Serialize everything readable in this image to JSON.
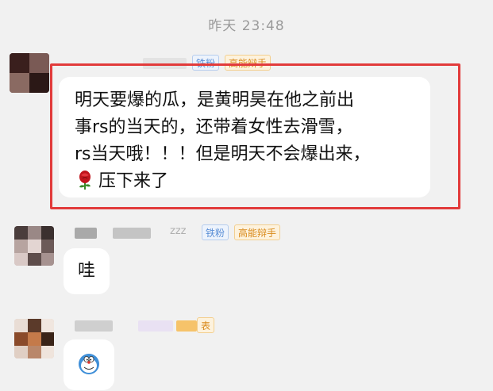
{
  "timestamp": "昨天 23:48",
  "messages": [
    {
      "badges": {
        "fan": "铁粉",
        "level": "高能辩手"
      },
      "text_lines": [
        "明天要爆的瓜，是黄明昊在他之前出",
        "事rs的当天的，还带着女性去滑雪，",
        "rs当天哦！！！但是明天不会爆出来，",
        "压下来了"
      ],
      "emoji": "rose-icon",
      "highlighted": true,
      "highlight_color": "#e23b3b"
    },
    {
      "name_suffix": "zzz",
      "badges": {
        "fan": "铁粉",
        "level": "高能辩手"
      },
      "text": "哇"
    },
    {
      "badges": {
        "level_partial": "表"
      },
      "sticker": "doraemon-sticker-icon"
    }
  ],
  "colors": {
    "background": "#f1f1f1",
    "bubble": "#ffffff",
    "fan_badge": "#5b8fd6",
    "level_badge": "#d98a1a"
  }
}
